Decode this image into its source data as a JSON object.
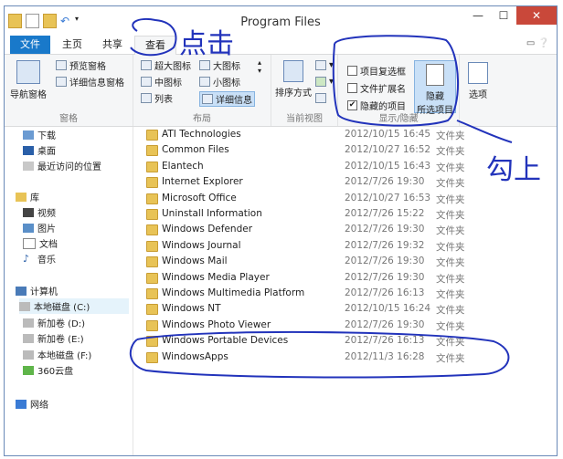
{
  "window": {
    "title": "Program Files"
  },
  "tabs": {
    "file": "文件",
    "home": "主页",
    "share": "共享",
    "view": "查看"
  },
  "ribbon": {
    "nav_pane": "导航窗格",
    "preview_pane": "预览窗格",
    "details_pane": "详细信息窗格",
    "group_pane": "窗格",
    "xlarge_icons": "超大图标",
    "large_icons": "大图标",
    "medium_icons": "中图标",
    "small_icons": "小图标",
    "list": "列表",
    "details": "详细信息",
    "group_layout": "布局",
    "sort_by": "排序方式",
    "group_current_view": "当前视图",
    "item_checkboxes": "项目复选框",
    "file_extensions": "文件扩展名",
    "hidden_items": "隐藏的项目",
    "hide_selected_1": "隐藏",
    "hide_selected_2": "所选项目",
    "group_show_hide": "显示/隐藏",
    "options": "选项"
  },
  "nav": {
    "items": [
      {
        "label": "下载"
      },
      {
        "label": "桌面"
      },
      {
        "label": "最近访问的位置"
      },
      {
        "label": "库"
      },
      {
        "label": "视频"
      },
      {
        "label": "图片"
      },
      {
        "label": "文档"
      },
      {
        "label": "音乐"
      },
      {
        "label": "计算机"
      },
      {
        "label": "本地磁盘 (C:)"
      },
      {
        "label": "新加卷 (D:)"
      },
      {
        "label": "新加卷 (E:)"
      },
      {
        "label": "本地磁盘 (F:)"
      },
      {
        "label": "360云盘"
      },
      {
        "label": "网络"
      }
    ]
  },
  "files": [
    {
      "name": "ATI Technologies",
      "date": "2012/10/15 16:45",
      "type": "文件夹"
    },
    {
      "name": "Common Files",
      "date": "2012/10/27 16:52",
      "type": "文件夹"
    },
    {
      "name": "Elantech",
      "date": "2012/10/15 16:43",
      "type": "文件夹"
    },
    {
      "name": "Internet Explorer",
      "date": "2012/7/26 19:30",
      "type": "文件夹"
    },
    {
      "name": "Microsoft Office",
      "date": "2012/10/27 16:53",
      "type": "文件夹"
    },
    {
      "name": "Uninstall Information",
      "date": "2012/7/26 15:22",
      "type": "文件夹"
    },
    {
      "name": "Windows Defender",
      "date": "2012/7/26 19:30",
      "type": "文件夹"
    },
    {
      "name": "Windows Journal",
      "date": "2012/7/26 19:32",
      "type": "文件夹"
    },
    {
      "name": "Windows Mail",
      "date": "2012/7/26 19:30",
      "type": "文件夹"
    },
    {
      "name": "Windows Media Player",
      "date": "2012/7/26 19:30",
      "type": "文件夹"
    },
    {
      "name": "Windows Multimedia Platform",
      "date": "2012/7/26 16:13",
      "type": "文件夹"
    },
    {
      "name": "Windows NT",
      "date": "2012/10/15 16:24",
      "type": "文件夹"
    },
    {
      "name": "Windows Photo Viewer",
      "date": "2012/7/26 19:30",
      "type": "文件夹"
    },
    {
      "name": "Windows Portable Devices",
      "date": "2012/7/26 16:13",
      "type": "文件夹"
    },
    {
      "name": "WindowsApps",
      "date": "2012/11/3 16:28",
      "type": "文件夹"
    }
  ],
  "annotations": {
    "click1": "点击",
    "click2": "勾上"
  }
}
